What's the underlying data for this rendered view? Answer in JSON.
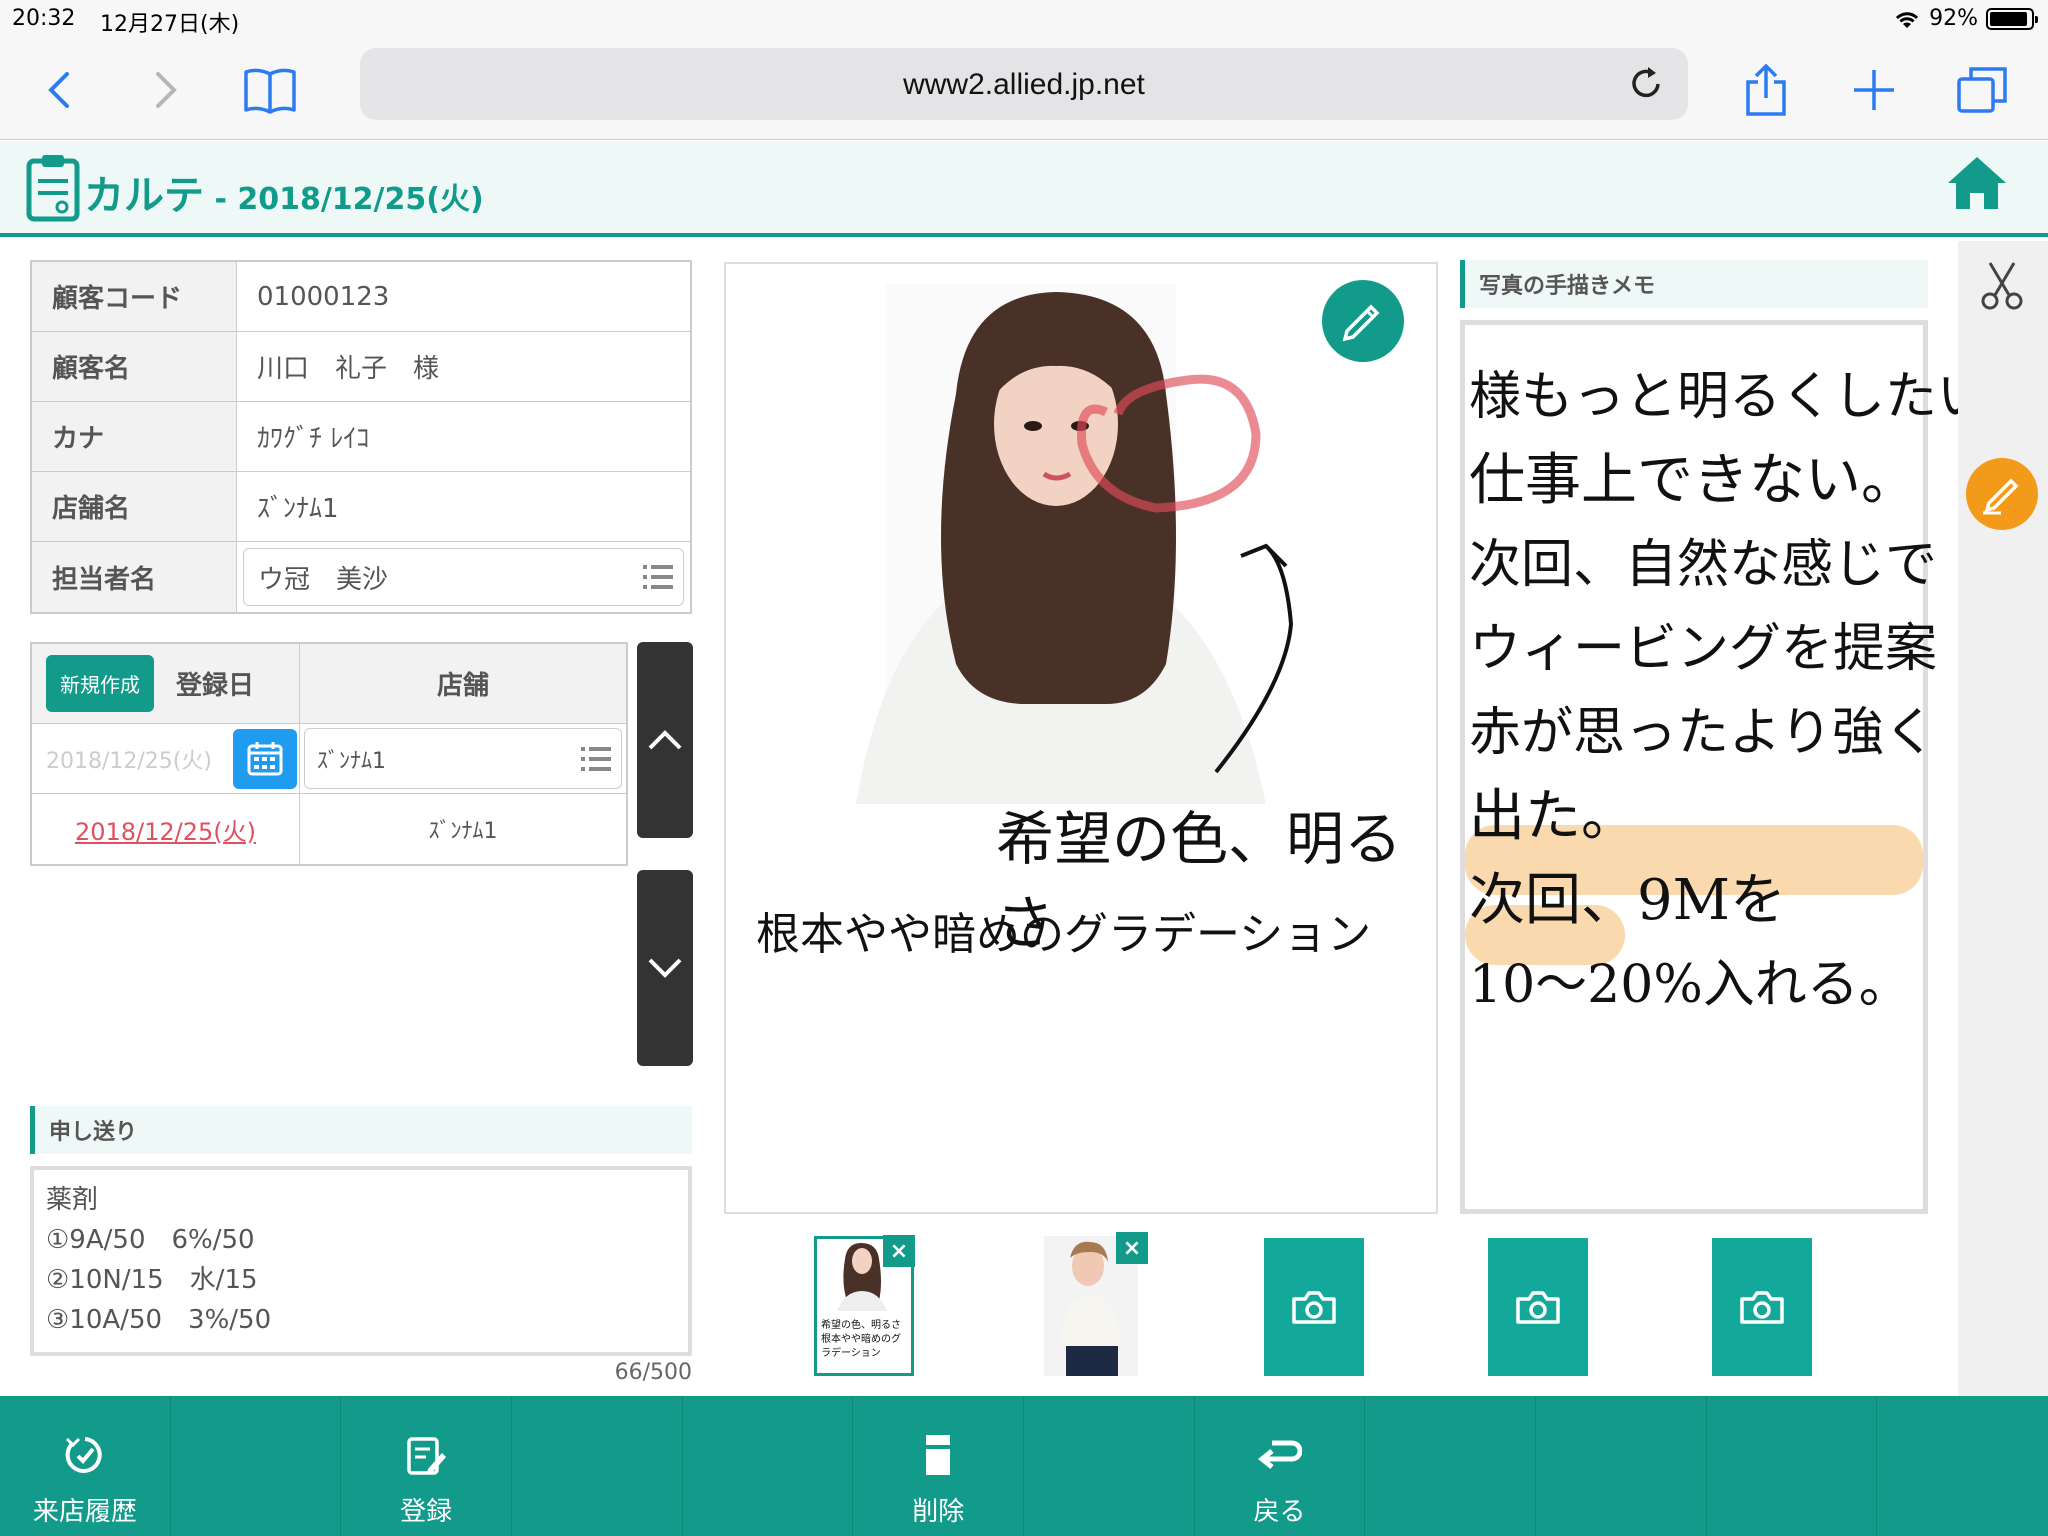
{
  "status": {
    "time": "20:32",
    "date": "12月27日(木)",
    "battery": "92%",
    "battery_level": 0.92
  },
  "browser": {
    "url": "www2.allied.jp.net"
  },
  "header": {
    "title": "カルテ",
    "separator": " - ",
    "date": "2018/12/25(火)"
  },
  "customer": {
    "rows": [
      {
        "label": "顧客コード",
        "value": "01000123"
      },
      {
        "label": "顧客名",
        "value": "川口　礼子　様"
      },
      {
        "label": "カナ",
        "value": "ｶﾜｸﾞﾁ ﾚｲｺ"
      },
      {
        "label": "店舗名",
        "value": "ｽﾞﾝﾅﾑ1"
      },
      {
        "label": "担当者名",
        "value": "ウ冠　美沙"
      }
    ]
  },
  "visits": {
    "new_button": "新規作成",
    "col_date": "登録日",
    "col_store": "店舗",
    "entry_date": "2018/12/25(火)",
    "entry_store": "ｽﾞﾝﾅﾑ1",
    "rows": [
      {
        "date": "2018/12/25(火)",
        "store": "ｽﾞﾝﾅﾑ1"
      }
    ]
  },
  "notes": {
    "title": "申し送り",
    "lines": [
      "薬剤",
      "①9A/50　6%/50",
      "②10N/15　水/15",
      "③10A/50　3%/50"
    ],
    "count": "66/500"
  },
  "photo": {
    "handwriting": [
      "希望の色、明るさ",
      "根本やや暗めのグラデーション"
    ]
  },
  "memo": {
    "title": "写真の手描きメモ",
    "lines": [
      "様もっと明るくしたい。",
      "仕事上できない。",
      "次回、自然な感じで",
      "ウィービングを提案",
      "赤が思ったより強く",
      "出た。",
      "次回、9Mを",
      "10〜20%入れる。"
    ]
  },
  "thumbnails": {
    "thumb1_caption": "希望の色、明るさ 根本やや暗めのグラデーション"
  },
  "bottom": {
    "history": "来店履歴",
    "register": "登録",
    "delete": "削除",
    "back": "戻る"
  },
  "colors": {
    "accent": "#129a8a",
    "orange": "#f39a1a",
    "blue": "#1f9bf0",
    "link_red": "#e05060"
  }
}
